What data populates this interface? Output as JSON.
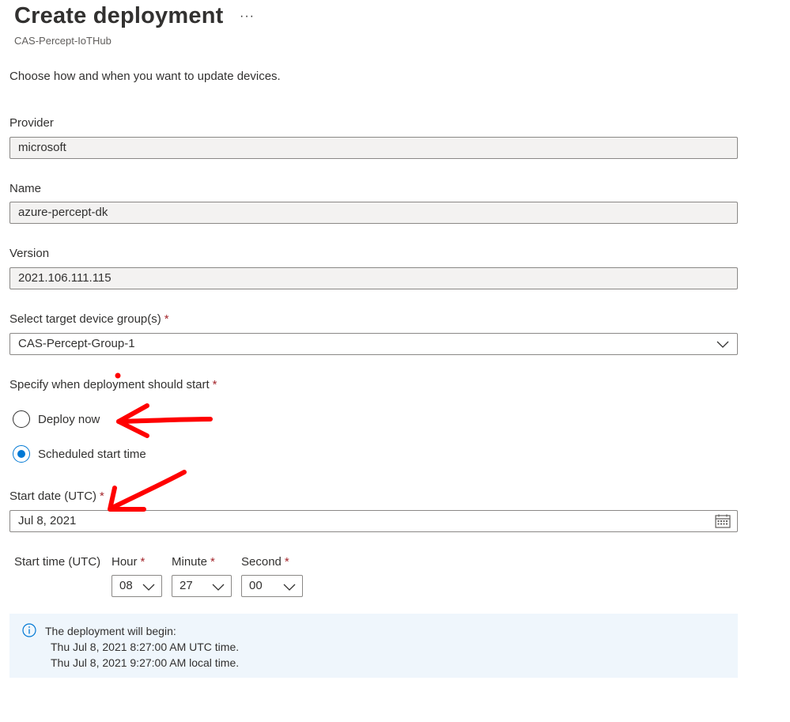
{
  "header": {
    "title": "Create deployment",
    "more_label": "···",
    "subtitle": "CAS-Percept-IoTHub"
  },
  "description": "Choose how and when you want to update devices.",
  "fields": {
    "provider": {
      "label": "Provider",
      "value": "microsoft"
    },
    "name": {
      "label": "Name",
      "value": "azure-percept-dk"
    },
    "version": {
      "label": "Version",
      "value": "2021.106.111.115"
    },
    "device_group": {
      "label": "Select target device group(s)",
      "required": "*",
      "value": "CAS-Percept-Group-1"
    }
  },
  "schedule": {
    "label": "Specify when deployment should start",
    "required": "*",
    "options": [
      {
        "label": "Deploy now",
        "checked": false
      },
      {
        "label": "Scheduled start time",
        "checked": true
      }
    ]
  },
  "start_date": {
    "label": "Start date (UTC)",
    "required": "*",
    "value": "Jul 8, 2021",
    "icon": "calendar-icon"
  },
  "start_time": {
    "label": "Start time (UTC)",
    "hour": {
      "label": "Hour",
      "required": "*",
      "value": "08"
    },
    "minute": {
      "label": "Minute",
      "required": "*",
      "value": "27"
    },
    "second": {
      "label": "Second",
      "required": "*",
      "value": "00"
    }
  },
  "info": {
    "icon": "info-icon",
    "heading": "The deployment will begin:",
    "utc_line": "Thu Jul 8, 2021 8:27:00 AM UTC time.",
    "local_line": "Thu Jul 8, 2021 9:27:00 AM local time."
  },
  "colors": {
    "accent": "#0078d4",
    "required": "#a4262c",
    "annotation": "#ff0000",
    "info_bg": "#eff6fc"
  }
}
